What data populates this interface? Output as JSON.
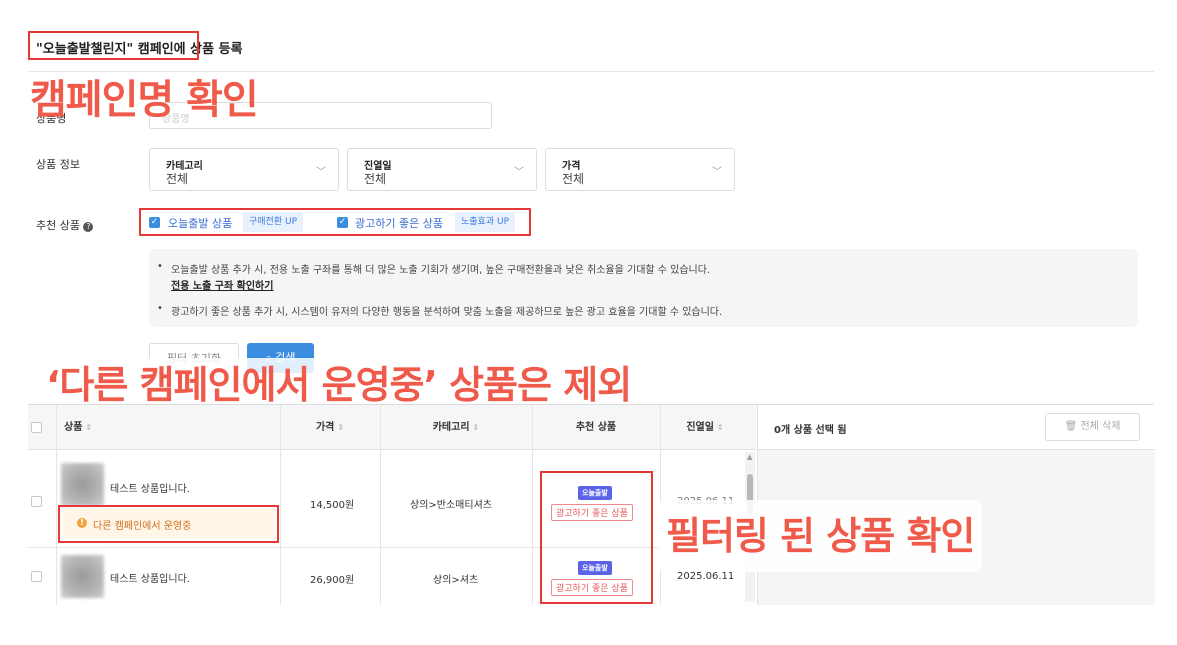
{
  "page": {
    "title": "\"오늘출발챌린지\" 캠페인에 상품 등록"
  },
  "annotations": {
    "campaign_check": "캠페인명 확인",
    "exclude_running": "‘다른 캠페인에서 운영중’ 상품은 제외",
    "filtered_check": "필터링 된 상품 확인"
  },
  "filters": {
    "name_label": "상품명",
    "name_placeholder": "상품명",
    "product_info_label": "상품 정보",
    "selects": [
      {
        "label": "카테고리",
        "value": "전체"
      },
      {
        "label": "진열일",
        "value": "전체"
      },
      {
        "label": "가격",
        "value": "전체"
      }
    ],
    "recommend_label": "추천 상품",
    "recommend_options": [
      {
        "label": "오늘출발 상품",
        "tag": "구매전환 UP"
      },
      {
        "label": "광고하기 좋은 상품",
        "tag": "노출효과 UP"
      }
    ],
    "info": {
      "line1": "오늘출발 상품 추가 시, 전용 노출 구좌를 통해 더 많은 노출 기회가 생기며, 높은 구매전환율과 낮은 취소율을 기대할 수 있습니다.",
      "link": "전용 노출 구좌 확인하기",
      "line2": "광고하기 좋은 상품 추가 시, 시스템이 유저의 다양한 행동을 분석하여 맞춤 노출을 제공하므로 높은 광고 효율을 기대할 수 있습니다."
    },
    "reset_button": "필터 초기화",
    "search_button": "검색"
  },
  "table": {
    "headers": [
      "상품",
      "가격",
      "카테고리",
      "추천 상품",
      "진열일"
    ],
    "rows": [
      {
        "name": "테스트 상품입니다.",
        "price": "14,500원",
        "category": "상의>반소매티셔츠",
        "badge_today": "오늘출발",
        "badge_ad": "광고하기 좋은 상품",
        "date": "2025.06.11",
        "warning": "다른 캠페인에서 운영중"
      },
      {
        "name": "테스트 상품입니다.",
        "price": "26,900원",
        "category": "상의>셔츠",
        "badge_today": "오늘출발",
        "badge_ad": "광고하기 좋은 상품",
        "date": "2025.06.11"
      }
    ]
  },
  "selection": {
    "count_text": "0개 상품 선택 됨",
    "delete_all": "전체 삭제"
  }
}
